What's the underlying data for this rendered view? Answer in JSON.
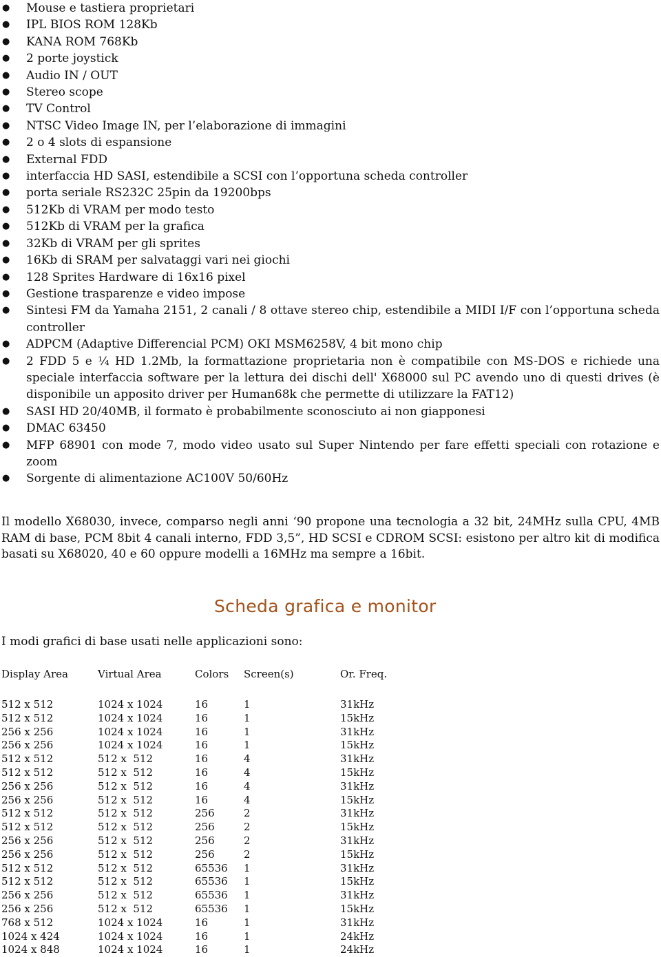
{
  "features": [
    "Mouse e tastiera proprietari",
    "IPL BIOS ROM 128Kb",
    "KANA ROM 768Kb",
    "2 porte joystick",
    "Audio IN / OUT",
    "Stereo scope",
    "TV Control",
    "NTSC Video Image IN, per l’elaborazione di immagini",
    "2 o 4 slots di espansione",
    "External FDD",
    "interfaccia HD SASI, estendibile a SCSI con l’opportuna scheda controller",
    "porta seriale RS232C 25pin da 19200bps",
    "512Kb di VRAM per modo testo",
    "512Kb di VRAM per la grafica",
    "32Kb di VRAM per gli sprites",
    "16Kb di SRAM per salvataggi vari nei giochi",
    "128 Sprites Hardware di 16x16 pixel",
    "Gestione trasparenze e video impose",
    "Sintesi FM da Yamaha 2151, 2 canali / 8 ottave stereo chip, estendibile a MIDI I/F con l’opportuna scheda controller",
    "ADPCM (Adaptive Differencial PCM) OKI MSM6258V, 4 bit mono chip",
    "2 FDD 5 e ¼ HD 1.2Mb, la formattazione proprietaria non è compatibile con MS-DOS e richiede una speciale interfaccia software per la lettura dei dischi dell' X68000 sul PC avendo uno di questi drives (è disponibile un apposito driver per Human68k che permette di utilizzare la FAT12)",
    "SASI HD 20/40MB, il formato è probabilmente sconosciuto ai non giapponesi",
    "DMAC 63450",
    "MFP 68901 con mode 7, modo video usato sul Super Nintendo per fare effetti speciali con rotazione e zoom",
    "Sorgente di alimentazione AC100V 50/60Hz"
  ],
  "bullet_glyph": "●",
  "paragraph": "Il modello X68030, invece, comparso negli anni ‘90 propone una tecnologia a 32 bit, 24MHz sulla CPU, 4MB RAM di base, PCM 8bit 4 canali interno, FDD 3,5”, HD SCSI e CDROM SCSI: esistono per altro kit di modifica basati su X68020, 40 e 60 oppure modelli a 16MHz ma sempre a 16bit.",
  "section_title": "Scheda grafica e monitor",
  "section_title_color": "#a2521a",
  "intro": "I modi grafici di base usati nelle applicazioni sono:",
  "table": {
    "headers": [
      "Display Area",
      "Virtual Area",
      "Colors",
      "Screen(s)",
      "Or. Freq."
    ],
    "rows": [
      [
        "512 x 512",
        "1024 x 1024",
        "16",
        "1",
        "31kHz"
      ],
      [
        "512 x 512",
        "1024 x 1024",
        "16",
        "1",
        "15kHz"
      ],
      [
        "256 x 256",
        "1024 x 1024",
        "16",
        "1",
        "31kHz"
      ],
      [
        "256 x 256",
        "1024 x 1024",
        "16",
        "1",
        "15kHz"
      ],
      [
        "512 x 512",
        "512 x  512",
        "16",
        "4",
        "31kHz"
      ],
      [
        "512 x 512",
        "512 x  512",
        "16",
        "4",
        "15kHz"
      ],
      [
        "256 x 256",
        "512 x  512",
        "16",
        "4",
        "31kHz"
      ],
      [
        "256 x 256",
        "512 x  512",
        "16",
        "4",
        "15kHz"
      ],
      [
        "512 x 512",
        "512 x  512",
        "256",
        "2",
        "31kHz"
      ],
      [
        "512 x 512",
        "512 x  512",
        "256",
        "2",
        "15kHz"
      ],
      [
        "256 x 256",
        "512 x  512",
        "256",
        "2",
        "31kHz"
      ],
      [
        "256 x 256",
        "512 x  512",
        "256",
        "2",
        "15kHz"
      ],
      [
        "512 x 512",
        "512 x  512",
        "65536",
        "1",
        "31kHz"
      ],
      [
        "512 x 512",
        "512 x  512",
        "65536",
        "1",
        "15kHz"
      ],
      [
        "256 x 256",
        "512 x  512",
        "65536",
        "1",
        "31kHz"
      ],
      [
        "256 x 256",
        "512 x  512",
        "65536",
        "1",
        "15kHz"
      ],
      [
        "768 x 512",
        "1024 x 1024",
        "16",
        "1",
        "31kHz"
      ],
      [
        "1024 x 424",
        "1024 x 1024",
        "16",
        "1",
        "24kHz"
      ],
      [
        "1024 x 848",
        "1024 x 1024",
        "16",
        "1",
        "24kHz"
      ]
    ]
  }
}
